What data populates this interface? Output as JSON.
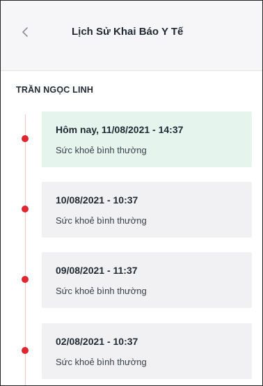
{
  "header": {
    "title": "Lịch Sử Khai Báo Y Tế",
    "back_icon": "chevron-left-icon"
  },
  "patient": {
    "name": "TRẦN NGỌC LINH"
  },
  "history": [
    {
      "date": "Hôm nay, 11/08/2021 - 14:37",
      "status": "Sức khoẻ bình thường",
      "highlight": true
    },
    {
      "date": "10/08/2021 - 10:37",
      "status": "Sức khoẻ bình thường",
      "highlight": false
    },
    {
      "date": "09/08/2021 - 11:37",
      "status": "Sức khoẻ bình thường",
      "highlight": false
    },
    {
      "date": "02/08/2021 - 10:37",
      "status": "Sức khoẻ bình thường",
      "highlight": false
    }
  ],
  "colors": {
    "today_card": "#e5f4ed",
    "past_card": "#f1f1f3",
    "timeline_dot": "#e0262f",
    "timeline_line": "#f0c9cc"
  }
}
